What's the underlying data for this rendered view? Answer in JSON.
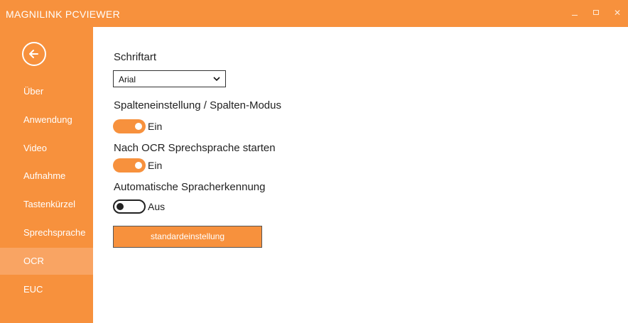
{
  "window": {
    "title": "MAGNILINK PCVIEWER"
  },
  "colors": {
    "accent": "#f7913d",
    "active_nav": "#f9a463"
  },
  "sidebar": {
    "back_icon": "back-arrow-circle-icon",
    "items": [
      {
        "label": "Über"
      },
      {
        "label": "Anwendung"
      },
      {
        "label": "Video"
      },
      {
        "label": "Aufnahme"
      },
      {
        "label": "Tastenkürzel"
      },
      {
        "label": "Sprechsprache"
      },
      {
        "label": "OCR",
        "active": true
      },
      {
        "label": "EUC"
      }
    ]
  },
  "settings": {
    "font": {
      "label": "Schriftart",
      "value": "Arial"
    },
    "column_mode": {
      "label": "Spalteneinstellung / Spalten-Modus",
      "state": "Ein",
      "on": true
    },
    "ocr_speech": {
      "label": "Nach OCR Sprechsprache starten",
      "state": "Ein",
      "on": true
    },
    "auto_lang": {
      "label": "Automatische Spracherkennung",
      "state": "Aus",
      "on": false
    },
    "reset_button": "standardeinstellung"
  }
}
